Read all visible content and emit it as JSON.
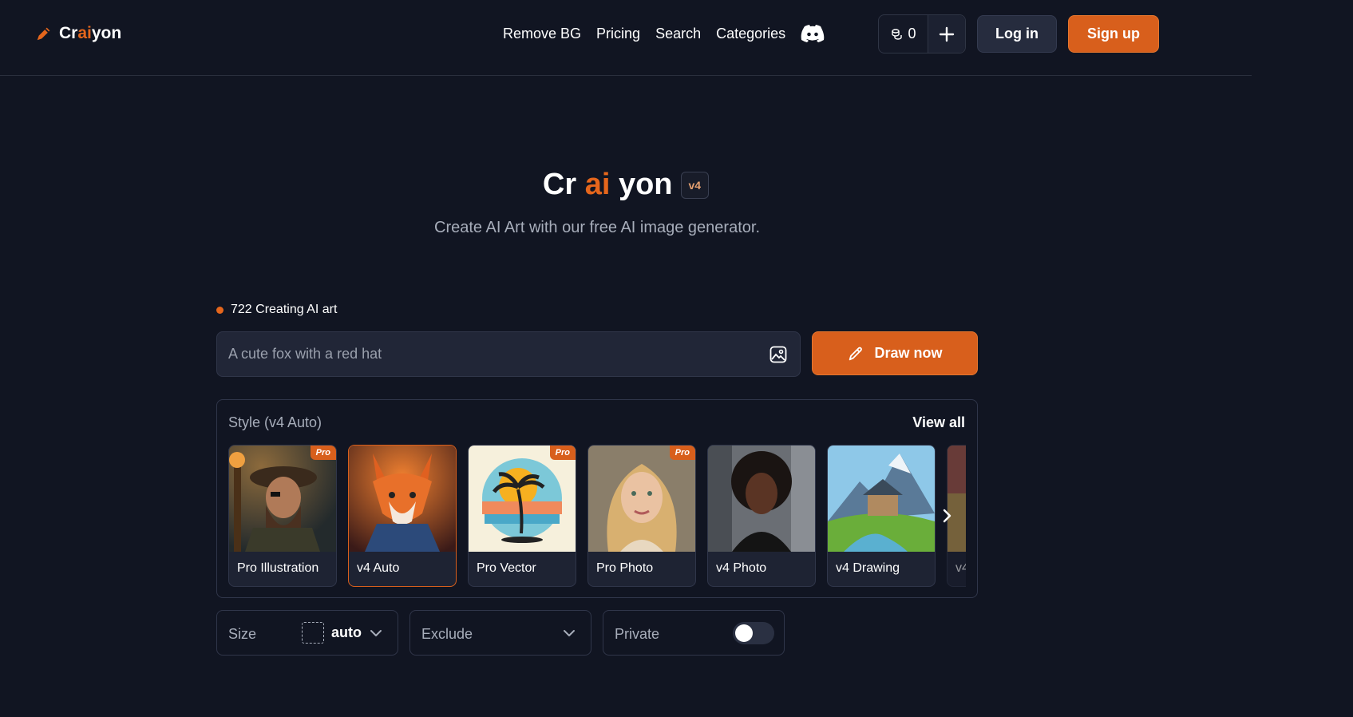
{
  "header": {
    "logo_parts": [
      "Cr",
      "ai",
      "yon"
    ],
    "nav": [
      "Remove BG",
      "Pricing",
      "Search",
      "Categories"
    ],
    "credits": "0",
    "login": "Log in",
    "signup": "Sign up"
  },
  "hero": {
    "title_parts": [
      "Cr",
      "ai",
      "yon"
    ],
    "version": "v4",
    "subtitle": "Create AI Art with our free AI image generator."
  },
  "status": {
    "count_text": "722 Creating AI art"
  },
  "prompt": {
    "placeholder": "A cute fox with a red hat",
    "draw_label": "Draw now"
  },
  "styles": {
    "title": "Style (v4 Auto)",
    "view_all": "View all",
    "items": [
      {
        "label": "Pro Illustration",
        "pro": "Pro"
      },
      {
        "label": "v4 Auto",
        "pro": ""
      },
      {
        "label": "Pro Vector",
        "pro": "Pro"
      },
      {
        "label": "Pro Photo",
        "pro": "Pro"
      },
      {
        "label": "v4 Photo",
        "pro": ""
      },
      {
        "label": "v4 Drawing",
        "pro": ""
      },
      {
        "label": "v4",
        "pro": ""
      }
    ]
  },
  "options": {
    "size_label": "Size",
    "size_value": "auto",
    "exclude_label": "Exclude",
    "private_label": "Private"
  },
  "colors": {
    "accent": "#d85f1c",
    "background": "#111522"
  }
}
